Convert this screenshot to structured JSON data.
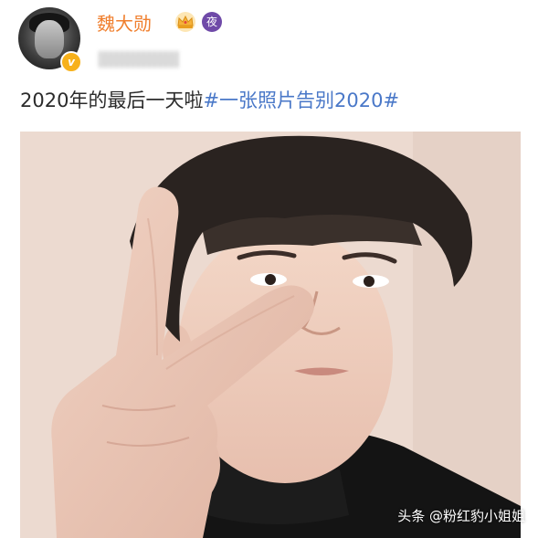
{
  "post": {
    "username": "魏大勋",
    "night_badge": "夜",
    "verified_badge": "v",
    "text_plain": "2020年的最后一天啦",
    "text_hashtag": "#一张照片告别2020#"
  },
  "icons": {
    "avatar": "avatar",
    "verified": "verified-badge-icon",
    "crown": "crown-icon",
    "night": "night-badge-icon"
  },
  "colors": {
    "username": "#f07f2e",
    "hashtag": "#4a78c8",
    "text": "#2b2b2b",
    "crown": "#f6b23a",
    "night_badge": "#6f4aa8"
  },
  "watermark": {
    "text": "头条 @粉红豹小姐姐"
  }
}
